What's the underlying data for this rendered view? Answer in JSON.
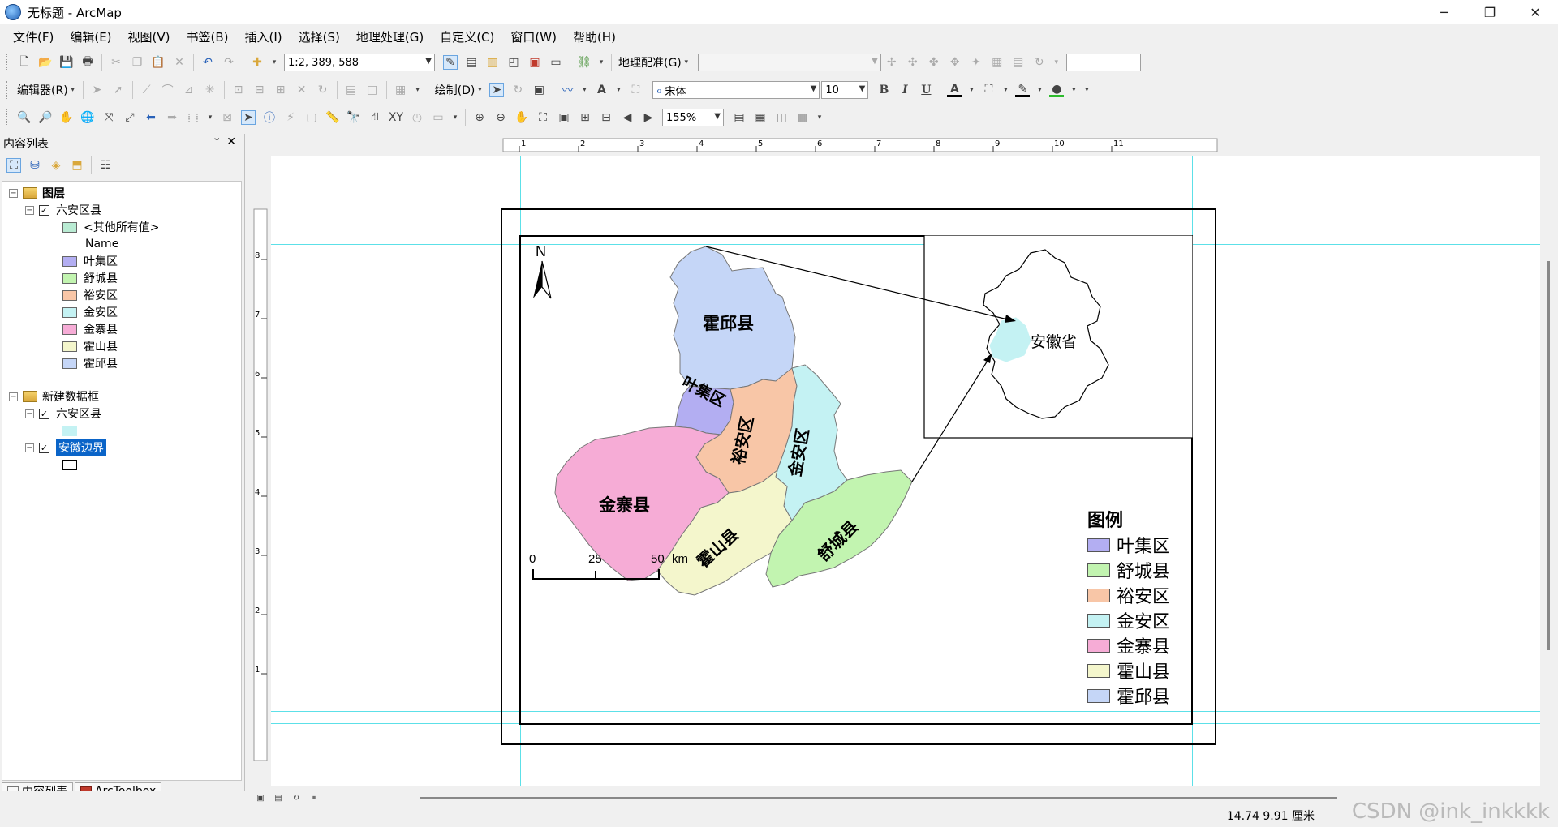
{
  "window": {
    "title": "无标题 - ArcMap",
    "controls": [
      "─",
      "❐",
      "✕"
    ]
  },
  "menu": [
    "文件(F)",
    "编辑(E)",
    "视图(V)",
    "书签(B)",
    "插入(I)",
    "选择(S)",
    "地理处理(G)",
    "自定义(C)",
    "窗口(W)",
    "帮助(H)"
  ],
  "toolbar1": {
    "scale": "1:2, 389, 588",
    "georef_label": "地理配准(G)"
  },
  "toolbar2": {
    "editor_label": "编辑器(R)",
    "draw_label": "绘制(D)",
    "font_name": "宋体",
    "font_size": "10",
    "bold": "B",
    "italic": "I",
    "underline": "U"
  },
  "toolbar3": {
    "zoom": "155%"
  },
  "toc": {
    "title": "内容列表",
    "pin": "ᛘ",
    "close": "✕",
    "tree": [
      {
        "type": "frame",
        "label": "图层"
      },
      {
        "type": "layer",
        "label": "六安区县",
        "checked": true
      },
      {
        "type": "class",
        "label": "<其他所有值>",
        "color": "#b9ebd3"
      },
      {
        "type": "header",
        "label": "Name"
      },
      {
        "type": "class",
        "label": "叶集区",
        "color": "#b3aef2"
      },
      {
        "type": "class",
        "label": "舒城县",
        "color": "#c2f4b0"
      },
      {
        "type": "class",
        "label": "裕安区",
        "color": "#f8c6a7"
      },
      {
        "type": "class",
        "label": "金安区",
        "color": "#c4f2f3"
      },
      {
        "type": "class",
        "label": "金寨县",
        "color": "#f6acd6"
      },
      {
        "type": "class",
        "label": "霍山县",
        "color": "#f4f6cc"
      },
      {
        "type": "class",
        "label": "霍邱县",
        "color": "#c5d6f7"
      },
      {
        "type": "frame",
        "label": "新建数据框"
      },
      {
        "type": "layer",
        "label": "六安区县",
        "checked": true
      },
      {
        "type": "class",
        "label": "",
        "color": "#c4f2f3"
      },
      {
        "type": "layer",
        "label": "安徽边界",
        "checked": true,
        "selected": true
      },
      {
        "type": "class",
        "label": "",
        "color": "#ffffff"
      }
    ],
    "tabs": [
      "内容列表",
      "ArcToolbox"
    ]
  },
  "map": {
    "north": "N",
    "counties": [
      {
        "name": "霍邱县",
        "color": "#c5d6f7"
      },
      {
        "name": "叶集区",
        "color": "#b3aef2"
      },
      {
        "name": "裕安区",
        "color": "#f8c6a7"
      },
      {
        "name": "金安区",
        "color": "#c4f2f3"
      },
      {
        "name": "金寨县",
        "color": "#f6acd6"
      },
      {
        "name": "霍山县",
        "color": "#f4f6cc"
      },
      {
        "name": "舒城县",
        "color": "#c2f4b0"
      }
    ],
    "inset_label": "安徽省",
    "scalebar": {
      "ticks": [
        "0",
        "25",
        "50"
      ],
      "unit": "km"
    }
  },
  "legend": {
    "title": "图例",
    "items": [
      {
        "label": "叶集区",
        "color": "#b3aef2"
      },
      {
        "label": "舒城县",
        "color": "#c2f4b0"
      },
      {
        "label": "裕安区",
        "color": "#f8c6a7"
      },
      {
        "label": "金安区",
        "color": "#c4f2f3"
      },
      {
        "label": "金寨县",
        "color": "#f6acd6"
      },
      {
        "label": "霍山县",
        "color": "#f4f6cc"
      },
      {
        "label": "霍邱县",
        "color": "#c5d6f7"
      }
    ]
  },
  "ruler": {
    "h_ticks": [
      "1",
      "2",
      "3",
      "4",
      "5",
      "6",
      "7",
      "8",
      "9",
      "10",
      "11"
    ],
    "v_ticks": [
      "8",
      "7",
      "6",
      "5",
      "4",
      "3",
      "2",
      "1"
    ]
  },
  "status": {
    "coords": "14.74  9.91 厘米",
    "watermark": "CSDN @ink_inkkkk"
  }
}
